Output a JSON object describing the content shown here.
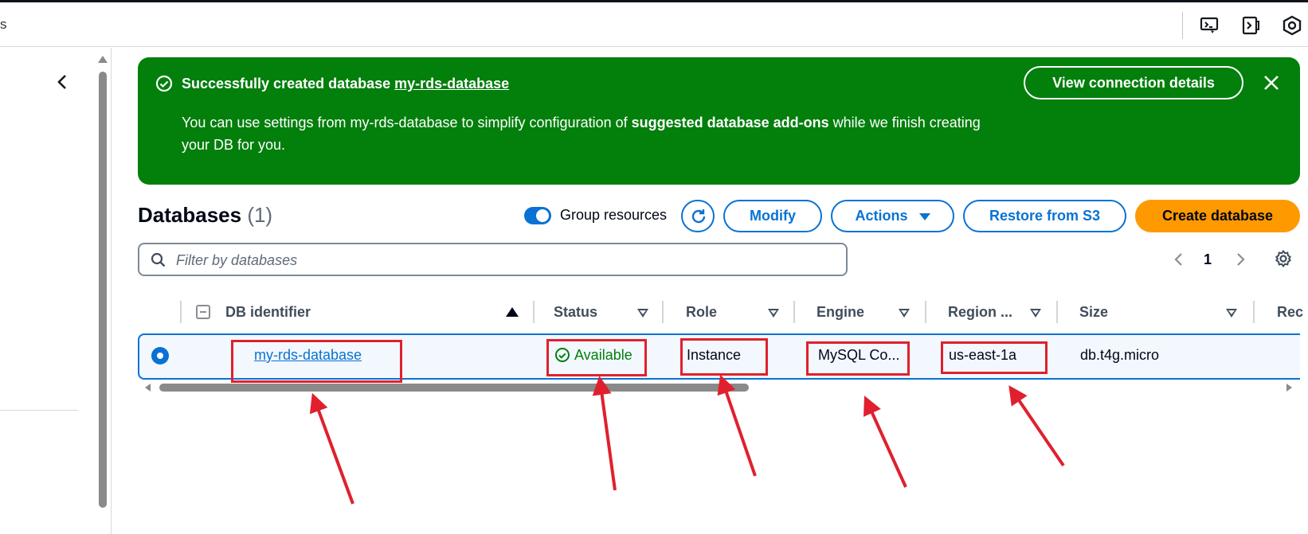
{
  "topbar": {
    "fragment": "s",
    "icons": [
      "cloudshell-icon",
      "console-panel-icon",
      "settings-hex-icon"
    ]
  },
  "flash": {
    "title_prefix": "Successfully created database ",
    "title_link": "my-rds-database",
    "body_part1": "You can use settings from my-rds-database to simplify configuration of ",
    "body_bold": "suggested database add-ons",
    "body_part2": " while we finish creating your DB for you.",
    "action_label": "View connection details",
    "color": "#037f0c"
  },
  "databases": {
    "title": "Databases",
    "count": "(1)",
    "group_toggle_label": "Group resources",
    "group_toggle_on": true,
    "buttons": {
      "modify": "Modify",
      "actions": "Actions",
      "restore": "Restore from S3",
      "create": "Create database"
    },
    "filter_placeholder": "Filter by databases",
    "page": "1",
    "columns": [
      "DB identifier",
      "Status",
      "Role",
      "Engine",
      "Region ...",
      "Size",
      "Rec"
    ],
    "rows": [
      {
        "selected": true,
        "db_identifier": "my-rds-database",
        "status": "Available",
        "role": "Instance",
        "engine": "MySQL Co...",
        "region": "us-east-1a",
        "size": "db.t4g.micro"
      }
    ]
  },
  "colors": {
    "accent": "#0972d3",
    "primary_button": "#ff9900",
    "success": "#037f0c",
    "annotation": "#e0202e"
  }
}
